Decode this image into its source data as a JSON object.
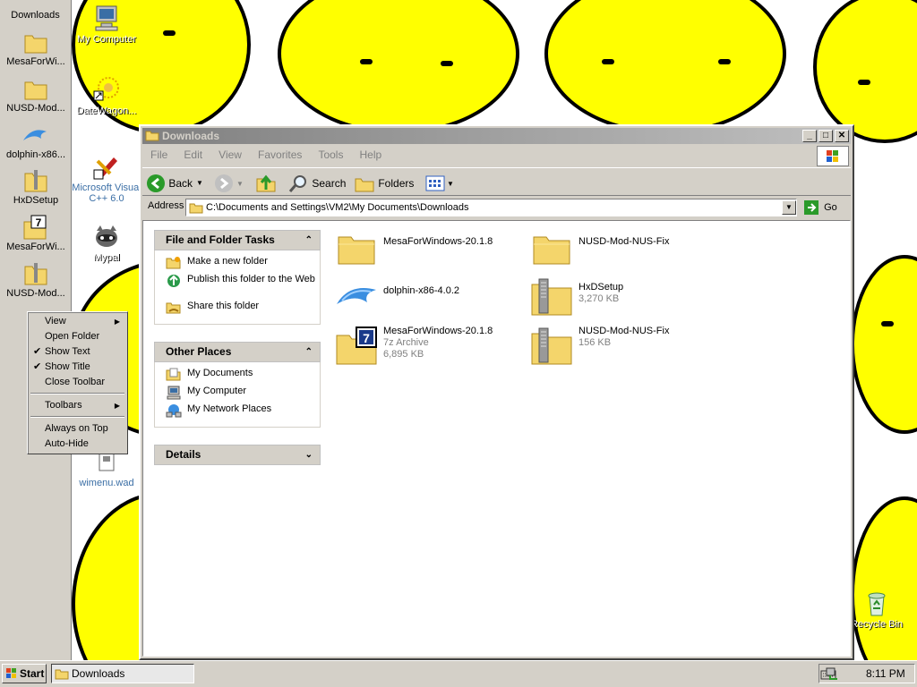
{
  "desktop": {
    "icons": [
      {
        "label": "My Computer",
        "icon": "my-computer-icon"
      },
      {
        "label": "DateWagon...",
        "icon": "shortcut-icon"
      },
      {
        "label": "Microsoft Visual C++ 6.0",
        "icon": "shortcut-icon"
      },
      {
        "label": "Mypal",
        "icon": "mypal-icon"
      },
      {
        "label": "wimenu.wad",
        "icon": "file-icon"
      },
      {
        "label": "Recycle Bin",
        "icon": "recycle-bin-icon"
      }
    ]
  },
  "quicktoolbar": {
    "title": "Downloads",
    "items": [
      {
        "label": "MesaForWi...",
        "icon": "folder-icon"
      },
      {
        "label": "NUSD-Mod...",
        "icon": "folder-icon"
      },
      {
        "label": "dolphin-x86...",
        "icon": "dolphin-icon"
      },
      {
        "label": "HxDSetup",
        "icon": "zip-icon"
      },
      {
        "label": "MesaForWi...",
        "icon": "7z-icon"
      },
      {
        "label": "NUSD-Mod...",
        "icon": "zip-icon"
      }
    ]
  },
  "contextmenu": {
    "items": [
      {
        "label": "View",
        "checked": false,
        "submenu": true
      },
      {
        "label": "Open Folder",
        "checked": false,
        "submenu": false
      },
      {
        "label": "Show Text",
        "checked": true,
        "submenu": false
      },
      {
        "label": "Show Title",
        "checked": true,
        "submenu": false
      },
      {
        "label": "Close Toolbar",
        "checked": false,
        "submenu": false
      },
      {
        "label": "Toolbars",
        "checked": false,
        "submenu": true
      },
      {
        "label": "Always on Top",
        "checked": false,
        "submenu": false
      },
      {
        "label": "Auto-Hide",
        "checked": false,
        "submenu": false
      }
    ]
  },
  "window": {
    "title": "Downloads",
    "menu": [
      "File",
      "Edit",
      "View",
      "Favorites",
      "Tools",
      "Help"
    ],
    "toolbar": {
      "back": "Back",
      "search": "Search",
      "folders": "Folders"
    },
    "address_label": "Address",
    "address_value": "C:\\Documents and Settings\\VM2\\My Documents\\Downloads",
    "go_label": "Go"
  },
  "tasks": {
    "file_tasks_title": "File and Folder Tasks",
    "file_tasks": [
      {
        "label": "Make a new folder",
        "icon": "new-folder-icon"
      },
      {
        "label": "Publish this folder to the Web",
        "icon": "publish-web-icon"
      },
      {
        "label": "Share this folder",
        "icon": "share-folder-icon"
      }
    ],
    "other_places_title": "Other Places",
    "other_places": [
      {
        "label": "My Documents",
        "icon": "my-documents-icon"
      },
      {
        "label": "My Computer",
        "icon": "my-computer-icon"
      },
      {
        "label": "My Network Places",
        "icon": "network-places-icon"
      }
    ],
    "details_title": "Details"
  },
  "files": [
    {
      "name": "MesaForWindows-20.1.8",
      "type": "",
      "size": "",
      "icon": "folder-icon"
    },
    {
      "name": "NUSD-Mod-NUS-Fix",
      "type": "",
      "size": "",
      "icon": "folder-icon"
    },
    {
      "name": "dolphin-x86-4.0.2",
      "type": "",
      "size": "",
      "icon": "dolphin-icon"
    },
    {
      "name": "HxDSetup",
      "type": "",
      "size": "3,270 KB",
      "icon": "zip-icon"
    },
    {
      "name": "MesaForWindows-20.1.8",
      "type": "7z Archive",
      "size": "6,895 KB",
      "icon": "7z-icon"
    },
    {
      "name": "NUSD-Mod-NUS-Fix",
      "type": "",
      "size": "156 KB",
      "icon": "zip-icon"
    }
  ],
  "taskbar": {
    "start": "Start",
    "window_button": "Downloads",
    "clock": "8:11 PM"
  }
}
